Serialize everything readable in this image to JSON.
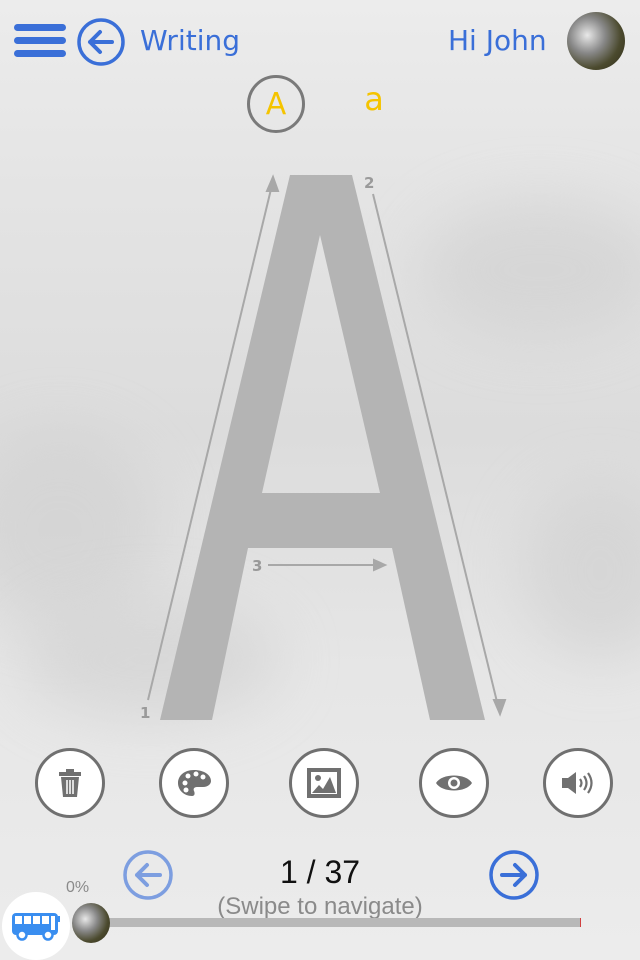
{
  "header": {
    "title": "Writing",
    "greeting": "Hi John",
    "menu_icon": "hamburger-icon",
    "back_icon": "arrow-left-circle-icon"
  },
  "case_toggle": {
    "upper": "A",
    "lower": "a",
    "selected": "upper",
    "color": "#f5c400"
  },
  "letter": {
    "glyph": "A",
    "stroke_numbers": [
      "1",
      "2",
      "3"
    ]
  },
  "toolbar": {
    "items": [
      "trash-icon",
      "palette-icon",
      "image-icon",
      "eye-icon",
      "speaker-icon"
    ]
  },
  "nav": {
    "page": "1 / 37",
    "hint": "(Swipe to navigate)",
    "prev_icon": "arrow-left-circle-icon",
    "next_icon": "arrow-right-circle-icon"
  },
  "progress": {
    "label": "0%",
    "value": 0
  },
  "colors": {
    "accent": "#3a6fd8",
    "letter": "#b4b4b4",
    "yellow": "#f5c400"
  }
}
